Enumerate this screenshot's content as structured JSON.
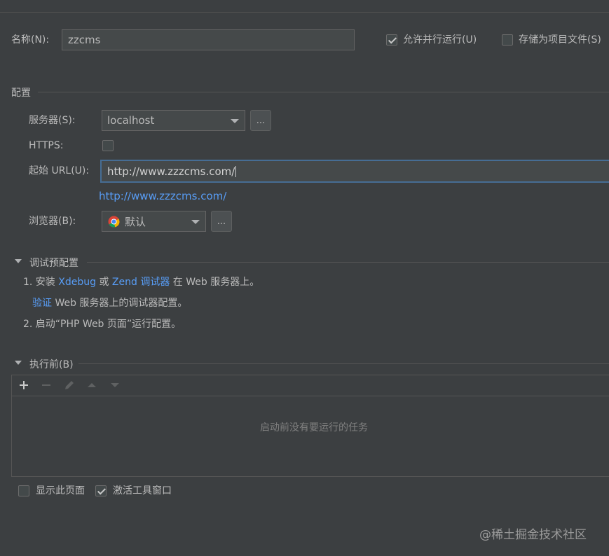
{
  "name": {
    "label": "名称(N):",
    "value": "zzcms"
  },
  "allow_parallel": {
    "label": "允许并行运行(U)",
    "checked": true
  },
  "store_as_project": {
    "label": "存储为项目文件(S)",
    "checked": false
  },
  "config": {
    "section_title": "配置",
    "server": {
      "label": "服务器(S):",
      "value": "localhost",
      "more": "..."
    },
    "https": {
      "label": "HTTPS:",
      "checked": false
    },
    "start_url": {
      "label": "起始 URL(U):",
      "value": "http://www.zzzcms.com/",
      "preview": "http://www.zzzcms.com/"
    },
    "browser": {
      "label": "浏览器(B):",
      "value": "默认",
      "more": "..."
    }
  },
  "debug": {
    "title": "调试预配置",
    "step1_prefix": "1. 安装",
    "xdebug": "Xdebug",
    "or": "或",
    "zend": "Zend 调试器",
    "step1_suffix": "在 Web 服务器上。",
    "verify": "验证",
    "verify_suffix": "Web 服务器上的调试器配置。",
    "step2": "2. 启动“PHP Web 页面”运行配置。"
  },
  "before_launch": {
    "title": "执行前(B)",
    "empty": "启动前没有要运行的任务",
    "toolbar": [
      "add-icon",
      "remove-icon",
      "edit-icon",
      "move-up-icon",
      "move-down-icon"
    ]
  },
  "show_page": {
    "label": "显示此页面",
    "checked": false
  },
  "activate_tool": {
    "label": "激活工具窗口",
    "checked": true
  },
  "watermark": "@稀土掘金技术社区",
  "colors": {
    "background": "#3c3f41",
    "link": "#589df6",
    "focus_border": "#466d94"
  }
}
